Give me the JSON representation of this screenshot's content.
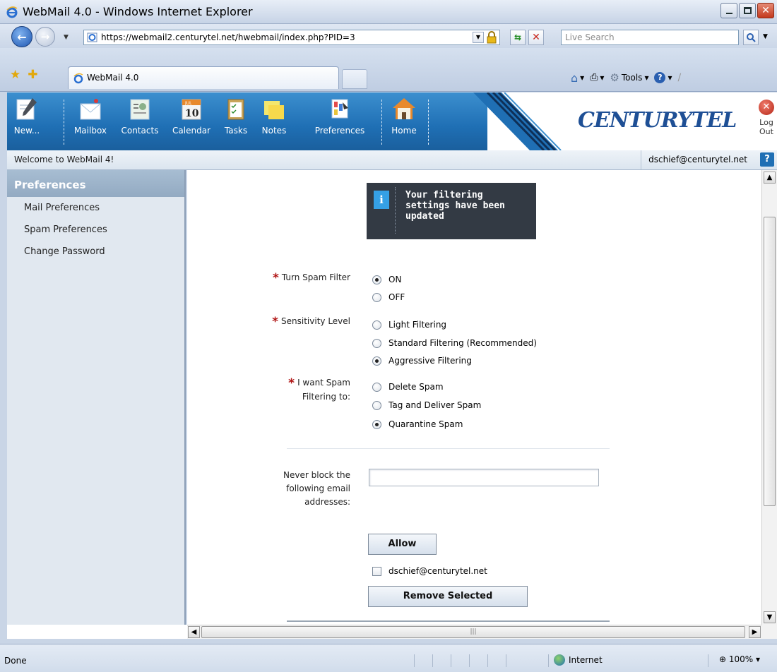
{
  "browser": {
    "window_title": "WebMail 4.0 - Windows Internet Explorer",
    "url": "https://webmail2.centurytel.net/hwebmail/index.php?PID=3",
    "search_placeholder": "Live Search",
    "tab_title": "WebMail 4.0",
    "tools_label": "Tools",
    "status_text": "Done",
    "zone_label": "Internet",
    "zoom_label": "100%"
  },
  "toolbar": {
    "new_label": "New...",
    "mailbox_label": "Mailbox",
    "contacts_label": "Contacts",
    "calendar_label": "Calendar",
    "calendar_month": "JUL",
    "calendar_day": "10",
    "tasks_label": "Tasks",
    "notes_label": "Notes",
    "preferences_label": "Preferences",
    "home_label": "Home",
    "brand_logo": "CENTURYTEL",
    "logout_label": "Log Out"
  },
  "welcome": {
    "message": "Welcome to WebMail 4!",
    "user_email": "dschief@centurytel.net",
    "help_label": "?"
  },
  "sidebar": {
    "heading": "Preferences",
    "items": [
      {
        "label": "Mail Preferences"
      },
      {
        "label": "Spam Preferences"
      },
      {
        "label": "Change Password"
      }
    ]
  },
  "notice": {
    "icon_label": "i",
    "message": "Your filtering settings have been updated"
  },
  "form": {
    "spam_filter": {
      "label": "Turn Spam Filter",
      "options": [
        {
          "label": "ON",
          "selected": true
        },
        {
          "label": "OFF",
          "selected": false
        }
      ]
    },
    "sensitivity": {
      "label": "Sensitivity Level",
      "options": [
        {
          "label": "Light Filtering",
          "selected": false
        },
        {
          "label": "Standard Filtering (Recommended)",
          "selected": false
        },
        {
          "label": "Aggressive Filtering",
          "selected": true
        }
      ]
    },
    "action": {
      "label": "I want Spam Filtering to:",
      "options": [
        {
          "label": "Delete Spam",
          "selected": false
        },
        {
          "label": "Tag and Deliver Spam",
          "selected": false
        },
        {
          "label": "Quarantine Spam",
          "selected": true
        }
      ]
    },
    "never_block": {
      "label": "Never block the following email addresses:",
      "value": "",
      "allow_button": "Allow",
      "entries": [
        {
          "address": "dschief@centurytel.net",
          "checked": false
        }
      ],
      "remove_button": "Remove Selected"
    }
  },
  "colors": {
    "header_blue": "#1f6fb4",
    "required_star": "#b01414",
    "notice_bg": "#333a44",
    "notice_icon": "#35a0e6"
  }
}
